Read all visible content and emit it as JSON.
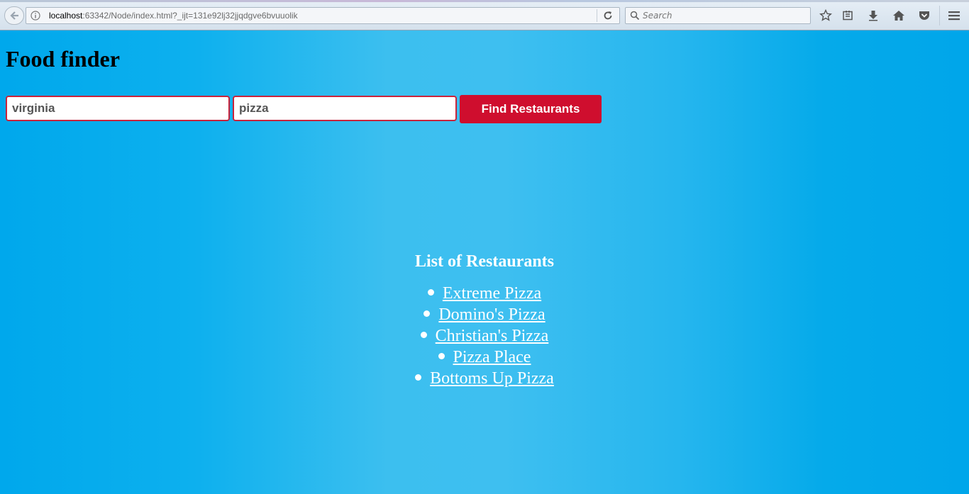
{
  "browser": {
    "url_host": "localhost",
    "url_rest": ":63342/Node/index.html?_ijt=131e92lj32jjqdgve6bvuuolik",
    "search_placeholder": "Search",
    "icons": [
      "back-arrow-icon",
      "info-icon",
      "reload-icon",
      "search-icon",
      "bookmark-star-icon",
      "reading-list-icon",
      "download-icon",
      "home-icon",
      "pocket-icon",
      "menu-icon"
    ]
  },
  "page": {
    "title": "Food finder",
    "location_value": "virginia",
    "food_value": "pizza",
    "find_button_label": "Find Restaurants",
    "results_heading": "List of Restaurants",
    "restaurants": [
      "Extreme Pizza",
      "Domino's Pizza",
      "Christian's Pizza",
      "Pizza Place",
      "Bottoms Up Pizza"
    ]
  },
  "colors": {
    "background": "#01a9ec",
    "button": "#cf0e2e",
    "field_border": "#c9233b"
  }
}
